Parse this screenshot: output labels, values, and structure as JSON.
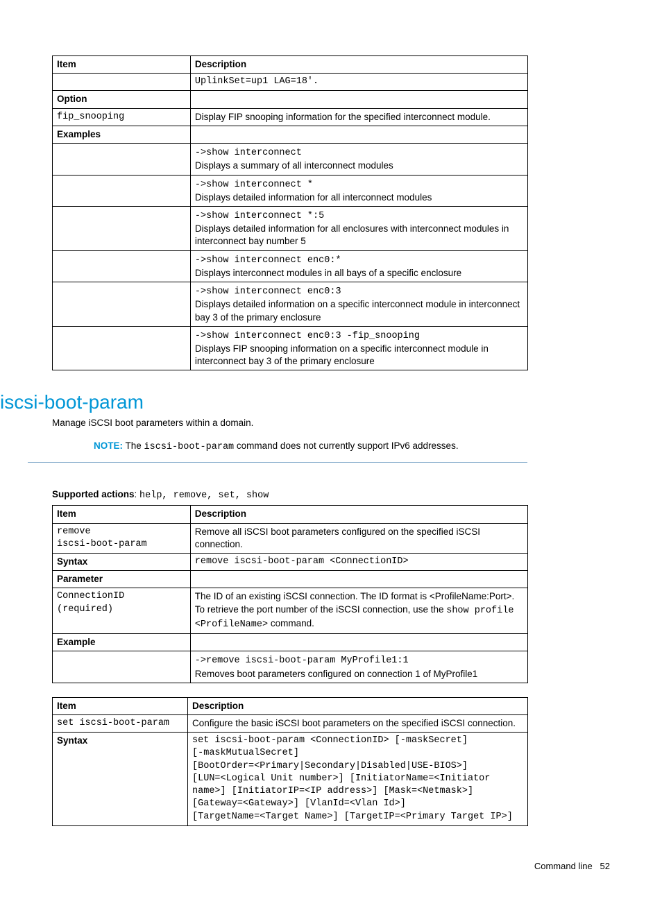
{
  "table1": {
    "h_item": "Item",
    "h_desc": "Description",
    "r1_desc": "UplinkSet=up1 LAG=18'.",
    "r2_item": "Option",
    "r3_item": "fip_snooping",
    "r3_desc": "Display FIP snooping information for the specified interconnect module.",
    "r4_item": "Examples",
    "r5_cmd": "->show interconnect",
    "r5_txt": "Displays a summary of all interconnect modules",
    "r6_cmd": "->show interconnect *",
    "r6_txt": "Displays detailed information for all interconnect modules",
    "r7_cmd": "->show interconnect *:5",
    "r7_txt": "Displays detailed information for all enclosures with interconnect modules in interconnect bay number 5",
    "r8_cmd": "->show interconnect enc0:*",
    "r8_txt": "Displays interconnect modules in all bays of a specific enclosure",
    "r9_cmd": "->show interconnect enc0:3",
    "r9_txt": "Displays detailed information on a specific interconnect module in interconnect bay 3 of the primary enclosure",
    "r10_cmd": "->show interconnect enc0:3 -fip_snooping",
    "r10_txt": "Displays FIP snooping information on a specific interconnect module in interconnect bay 3 of the primary enclosure"
  },
  "section": {
    "title": "iscsi-boot-param",
    "intro": "Manage iSCSI boot parameters within a domain.",
    "note_label": "NOTE:",
    "note_pre": "  The ",
    "note_code": "iscsi-boot-param",
    "note_post": " command does not currently support IPv6 addresses.",
    "supported_label": "Supported actions",
    "supported_sep": ": ",
    "supported_list": "help, remove, set, show"
  },
  "table2": {
    "h_item": "Item",
    "h_desc": "Description",
    "r1_l1": "remove",
    "r1_l2": "iscsi-boot-param",
    "r1_desc": "Remove all iSCSI boot parameters configured on the specified iSCSI connection.",
    "r2_item": "Syntax",
    "r2_desc": "remove iscsi-boot-param <ConnectionID>",
    "r3_item": "Parameter",
    "r4_l1": "ConnectionID",
    "r4_l2": "(required)",
    "r4_pre": "The ID of an existing iSCSI connection. The ID format is <ProfileName:Port>. To retrieve the port number of the iSCSI connection, use the ",
    "r4_c1": "show profile",
    "r4_mid": " ",
    "r4_c2": "<ProfileName>",
    "r4_post": " command.",
    "r5_item": "Example",
    "r6_cmd": "->remove iscsi-boot-param MyProfile1:1",
    "r6_txt": "Removes boot parameters configured on connection 1 of MyProfile1"
  },
  "table3": {
    "h_item": "Item",
    "h_desc": "Description",
    "r1_item": "set iscsi-boot-param",
    "r1_desc": "Configure the basic iSCSI boot parameters on the specified iSCSI connection.",
    "r2_item": "Syntax",
    "r2_l1": "set iscsi-boot-param <ConnectionID> [-maskSecret]",
    "r2_l2": "[-maskMutualSecret]",
    "r2_l3": "[BootOrder=<Primary|Secondary|Disabled|USE-BIOS>]",
    "r2_l4": "[LUN=<Logical Unit number>] [InitiatorName=<Initiator",
    "r2_l5": "name>] [InitiatorIP=<IP address>] [Mask=<Netmask>]",
    "r2_l6": "[Gateway=<Gateway>] [VlanId=<Vlan Id>]",
    "r2_l7": "[TargetName=<Target Name>] [TargetIP=<Primary Target IP>]"
  },
  "footer": {
    "label": "Command line",
    "page": "52"
  }
}
